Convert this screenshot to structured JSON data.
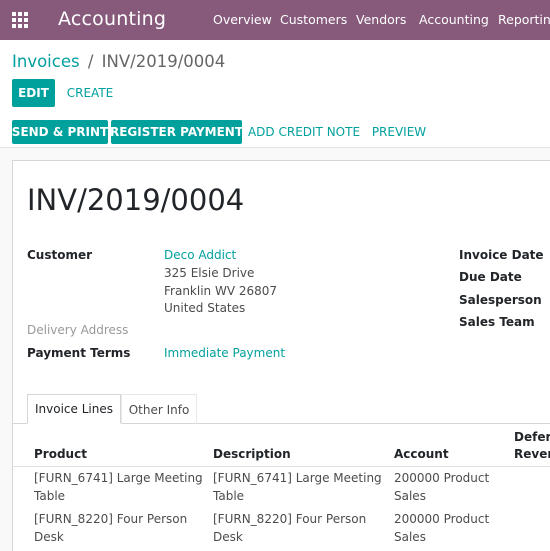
{
  "topbar": {
    "app_title": "Accounting",
    "menu": [
      "Overview",
      "Customers",
      "Vendors",
      "Accounting",
      "Reporting"
    ],
    "apps_icon": "grid-apps-icon",
    "color": "#875a7b"
  },
  "breadcrumb": {
    "parent": "Invoices",
    "separator": "/",
    "current": "INV/2019/0004"
  },
  "actions": {
    "edit": "EDIT",
    "create": "CREATE"
  },
  "statusbar": {
    "send_print": "SEND & PRINT",
    "register_payment": "REGISTER PAYMENT",
    "add_credit_note": "ADD CREDIT NOTE",
    "preview": "PREVIEW"
  },
  "invoice": {
    "number": "INV/2019/0004",
    "customer_label": "Customer",
    "customer_name": "Deco Addict",
    "address_line1": "325 Elsie Drive",
    "address_line2": "Franklin WV 26807",
    "address_line3": "United States",
    "delivery_address_label": "Delivery Address",
    "payment_terms_label": "Payment Terms",
    "payment_terms_value": "Immediate Payment",
    "invoice_date_label": "Invoice Date",
    "due_date_label": "Due Date",
    "salesperson_label": "Salesperson",
    "sales_team_label": "Sales Team"
  },
  "tabs": [
    "Invoice Lines",
    "Other Info"
  ],
  "lines": {
    "headers": {
      "product": "Product",
      "description": "Description",
      "account": "Account",
      "deferred_line1": "Deferre",
      "deferred_line2": "Revenu"
    },
    "rows": [
      {
        "product": "[FURN_6741] Large Meeting Table",
        "description": "[FURN_6741] Large Meeting Table",
        "account": "200000 Product Sales"
      },
      {
        "product": "[FURN_8220] Four Person Desk",
        "description": "[FURN_8220] Four Person Desk",
        "account": "200000 Product Sales"
      }
    ]
  },
  "colors": {
    "brand": "#875a7b",
    "primary": "#00a09d"
  }
}
